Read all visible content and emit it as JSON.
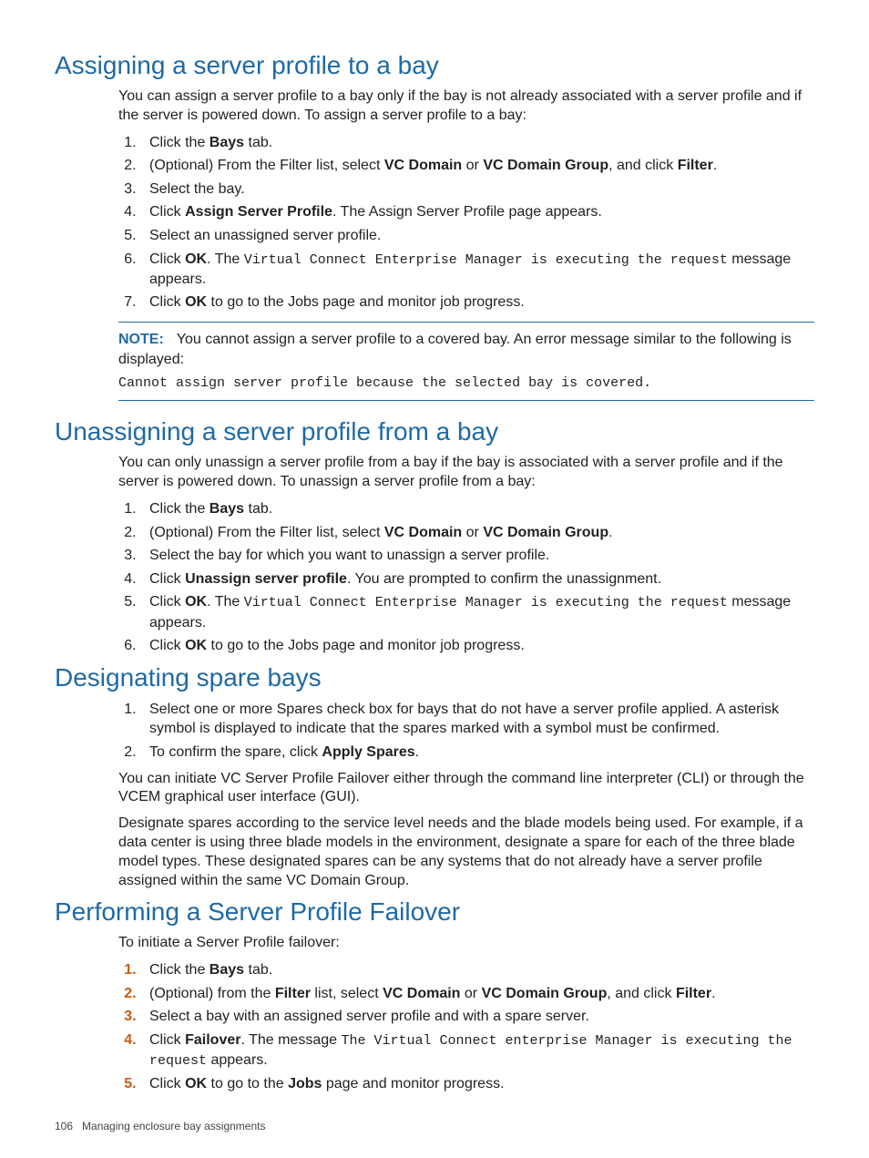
{
  "section1": {
    "heading": "Assigning a server profile to a bay",
    "intro": "You can assign a server profile to a bay only if the bay is not already associated with a server profile and if the server is powered down. To assign a server profile to a bay:",
    "steps": {
      "s1a": "Click the ",
      "s1b": "Bays",
      "s1c": " tab.",
      "s2a": "(Optional) From the Filter list, select ",
      "s2b": "VC Domain",
      "s2c": " or ",
      "s2d": "VC Domain Group",
      "s2e": ", and click ",
      "s2f": "Filter",
      "s2g": ".",
      "s3a": "Select the bay.",
      "s4a": "Click ",
      "s4b": "Assign Server Profile",
      "s4c": ". The Assign Server Profile page appears.",
      "s5a": "Select an unassigned server profile.",
      "s6a": "Click ",
      "s6b": "OK",
      "s6c": ". The ",
      "s6d": "Virtual Connect Enterprise Manager is executing the request",
      "s6e": " message appears.",
      "s7a": "Click ",
      "s7b": "OK",
      "s7c": " to go to the Jobs page and monitor job progress."
    },
    "note": {
      "label": "NOTE:",
      "text": "You cannot assign a server profile to a covered bay. An error message similar to the following is displayed:",
      "code": "Cannot assign server profile because the selected bay is covered."
    }
  },
  "section2": {
    "heading": "Unassigning a server profile from a bay",
    "intro": "You can only unassign a server profile from a bay if the bay is associated with a server profile and if the server is powered down. To unassign a server profile from a bay:",
    "steps": {
      "s1a": "Click the ",
      "s1b": "Bays",
      "s1c": " tab.",
      "s2a": "(Optional) From the Filter list, select ",
      "s2b": "VC Domain",
      "s2c": " or ",
      "s2d": "VC Domain Group",
      "s2e": ".",
      "s3a": "Select the bay for which you want to unassign a server profile.",
      "s4a": "Click ",
      "s4b": "Unassign server profile",
      "s4c": ". You are prompted to confirm the unassignment.",
      "s5a": "Click ",
      "s5b": "OK",
      "s5c": ". The ",
      "s5d": "Virtual Connect Enterprise Manager is executing the request",
      "s5e": " message appears.",
      "s6a": "Click ",
      "s6b": "OK",
      "s6c": " to go to the Jobs page and monitor job progress."
    }
  },
  "section3": {
    "heading": "Designating spare bays",
    "steps": {
      "s1a": "Select one or more Spares check box for bays that do not have a server profile applied. A asterisk symbol is displayed to indicate that the spares marked with a symbol must be confirmed.",
      "s2a": "To confirm the spare, click ",
      "s2b": "Apply Spares",
      "s2c": "."
    },
    "para1": "You can initiate VC Server Profile Failover either through the command line interpreter (CLI) or through the VCEM graphical user interface (GUI).",
    "para2": "Designate spares according to the service level needs and the blade models being used. For example, if a data center is using three blade models in the environment, designate a spare for each of the three blade model types. These designated spares can be any systems that do not already have a server profile assigned within the same VC Domain Group."
  },
  "section4": {
    "heading": "Performing a Server Profile Failover",
    "intro": "To initiate a Server Profile failover:",
    "steps": {
      "s1a": "Click the ",
      "s1b": "Bays",
      "s1c": " tab.",
      "s2a": "(Optional) from the ",
      "s2b": "Filter",
      "s2c": " list, select ",
      "s2d": "VC Domain",
      "s2e": " or ",
      "s2f": "VC Domain Group",
      "s2g": ", and click ",
      "s2h": "Filter",
      "s2i": ".",
      "s3a": "Select a bay with an assigned server profile and with a spare server.",
      "s4a": "Click ",
      "s4b": "Failover",
      "s4c": ". The message ",
      "s4d": "The Virtual Connect enterprise Manager is executing the request",
      "s4e": " appears.",
      "s5a": "Click ",
      "s5b": "OK",
      "s5c": " to go to the ",
      "s5d": "Jobs",
      "s5e": " page and monitor progress."
    }
  },
  "footer": {
    "page": "106",
    "title": "Managing enclosure bay assignments"
  }
}
